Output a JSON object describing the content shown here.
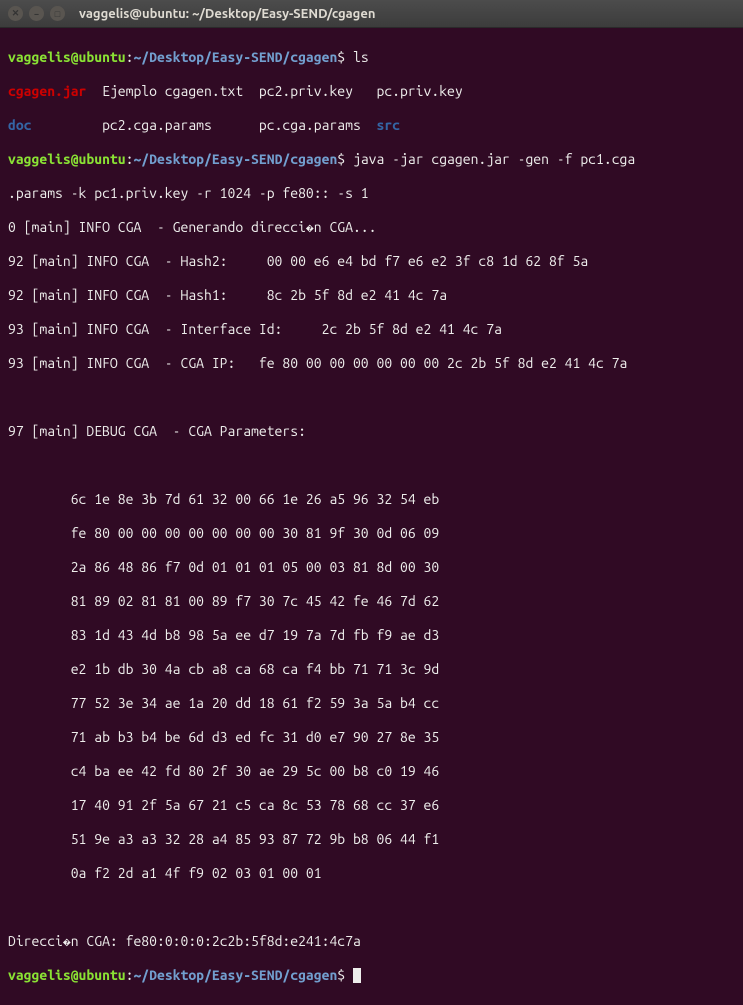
{
  "window": {
    "title": "vaggelis@ubuntu: ~/Desktop/Easy-SEND/cgagen"
  },
  "prompt": {
    "user_host": "vaggelis@ubuntu",
    "sep": ":",
    "path": "~/Desktop/Easy-SEND/cgagen",
    "dollar": "$"
  },
  "cmd": {
    "ls": " ls",
    "java": " java -jar cgagen.jar -gen -f pc1.cga",
    "empty": " "
  },
  "ls_out": {
    "row1": {
      "c1": "cgagen.jar",
      "c2": "  Ejemplo cgagen.txt  pc2.priv.key   pc.priv.key",
      "c2a": ""
    },
    "row2": {
      "c1": "doc",
      "c2": "         pc2.cga.params      pc.cga.params  ",
      "c3": "src"
    }
  },
  "wrap": {
    "line": ".params -k pc1.priv.key -r 1024 -p fe80:: -s 1"
  },
  "log": {
    "l1": "0 [main] INFO CGA  - Generando direcci",
    "l1b": "n CGA...",
    "l2": "92 [main] INFO CGA  - Hash2:     00 00 e6 e4 bd f7 e6 e2 3f c8 1d 62 8f 5a",
    "l3": "92 [main] INFO CGA  - Hash1:     8c 2b 5f 8d e2 41 4c 7a",
    "l4": "93 [main] INFO CGA  - Interface Id:     2c 2b 5f 8d e2 41 4c 7a",
    "l5": "93 [main] INFO CGA  - CGA IP:   fe 80 00 00 00 00 00 00 2c 2b 5f 8d e2 41 4c 7a",
    "l6": "97 [main] DEBUG CGA  - CGA Parameters:"
  },
  "params": {
    "r1": "        6c 1e 8e 3b 7d 61 32 00 66 1e 26 a5 96 32 54 eb",
    "r2": "        fe 80 00 00 00 00 00 00 00 30 81 9f 30 0d 06 09",
    "r3": "        2a 86 48 86 f7 0d 01 01 01 05 00 03 81 8d 00 30",
    "r4": "        81 89 02 81 81 00 89 f7 30 7c 45 42 fe 46 7d 62",
    "r5": "        83 1d 43 4d b8 98 5a ee d7 19 7a 7d fb f9 ae d3",
    "r6": "        e2 1b db 30 4a cb a8 ca 68 ca f4 bb 71 71 3c 9d",
    "r7": "        77 52 3e 34 ae 1a 20 dd 18 61 f2 59 3a 5a b4 cc",
    "r8": "        71 ab b3 b4 be 6d d3 ed fc 31 d0 e7 90 27 8e 35",
    "r9": "        c4 ba ee 42 fd 80 2f 30 ae 29 5c 00 b8 c0 19 46",
    "r10": "        17 40 91 2f 5a 67 21 c5 ca 8c 53 78 68 cc 37 e6",
    "r11": "        51 9e a3 a3 32 28 a4 85 93 87 72 9b b8 06 44 f1",
    "r12": "        0a f2 2d a1 4f f9 02 03 01 00 01"
  },
  "result": {
    "line_a": "Direcci",
    "line_b": "n CGA: fe80:0:0:0:2c2b:5f8d:e241:4c7a"
  },
  "diamond": "�"
}
